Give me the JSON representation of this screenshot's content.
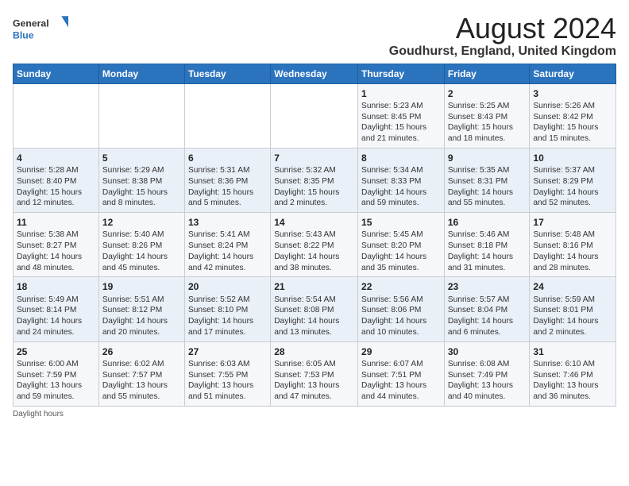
{
  "logo": {
    "line1": "General",
    "line2": "Blue"
  },
  "title": "August 2024",
  "subtitle": "Goudhurst, England, United Kingdom",
  "days_of_week": [
    "Sunday",
    "Monday",
    "Tuesday",
    "Wednesday",
    "Thursday",
    "Friday",
    "Saturday"
  ],
  "weeks": [
    [
      {
        "day": "",
        "content": ""
      },
      {
        "day": "",
        "content": ""
      },
      {
        "day": "",
        "content": ""
      },
      {
        "day": "",
        "content": ""
      },
      {
        "day": "1",
        "content": "Sunrise: 5:23 AM\nSunset: 8:45 PM\nDaylight: 15 hours\nand 21 minutes."
      },
      {
        "day": "2",
        "content": "Sunrise: 5:25 AM\nSunset: 8:43 PM\nDaylight: 15 hours\nand 18 minutes."
      },
      {
        "day": "3",
        "content": "Sunrise: 5:26 AM\nSunset: 8:42 PM\nDaylight: 15 hours\nand 15 minutes."
      }
    ],
    [
      {
        "day": "4",
        "content": "Sunrise: 5:28 AM\nSunset: 8:40 PM\nDaylight: 15 hours\nand 12 minutes."
      },
      {
        "day": "5",
        "content": "Sunrise: 5:29 AM\nSunset: 8:38 PM\nDaylight: 15 hours\nand 8 minutes."
      },
      {
        "day": "6",
        "content": "Sunrise: 5:31 AM\nSunset: 8:36 PM\nDaylight: 15 hours\nand 5 minutes."
      },
      {
        "day": "7",
        "content": "Sunrise: 5:32 AM\nSunset: 8:35 PM\nDaylight: 15 hours\nand 2 minutes."
      },
      {
        "day": "8",
        "content": "Sunrise: 5:34 AM\nSunset: 8:33 PM\nDaylight: 14 hours\nand 59 minutes."
      },
      {
        "day": "9",
        "content": "Sunrise: 5:35 AM\nSunset: 8:31 PM\nDaylight: 14 hours\nand 55 minutes."
      },
      {
        "day": "10",
        "content": "Sunrise: 5:37 AM\nSunset: 8:29 PM\nDaylight: 14 hours\nand 52 minutes."
      }
    ],
    [
      {
        "day": "11",
        "content": "Sunrise: 5:38 AM\nSunset: 8:27 PM\nDaylight: 14 hours\nand 48 minutes."
      },
      {
        "day": "12",
        "content": "Sunrise: 5:40 AM\nSunset: 8:26 PM\nDaylight: 14 hours\nand 45 minutes."
      },
      {
        "day": "13",
        "content": "Sunrise: 5:41 AM\nSunset: 8:24 PM\nDaylight: 14 hours\nand 42 minutes."
      },
      {
        "day": "14",
        "content": "Sunrise: 5:43 AM\nSunset: 8:22 PM\nDaylight: 14 hours\nand 38 minutes."
      },
      {
        "day": "15",
        "content": "Sunrise: 5:45 AM\nSunset: 8:20 PM\nDaylight: 14 hours\nand 35 minutes."
      },
      {
        "day": "16",
        "content": "Sunrise: 5:46 AM\nSunset: 8:18 PM\nDaylight: 14 hours\nand 31 minutes."
      },
      {
        "day": "17",
        "content": "Sunrise: 5:48 AM\nSunset: 8:16 PM\nDaylight: 14 hours\nand 28 minutes."
      }
    ],
    [
      {
        "day": "18",
        "content": "Sunrise: 5:49 AM\nSunset: 8:14 PM\nDaylight: 14 hours\nand 24 minutes."
      },
      {
        "day": "19",
        "content": "Sunrise: 5:51 AM\nSunset: 8:12 PM\nDaylight: 14 hours\nand 20 minutes."
      },
      {
        "day": "20",
        "content": "Sunrise: 5:52 AM\nSunset: 8:10 PM\nDaylight: 14 hours\nand 17 minutes."
      },
      {
        "day": "21",
        "content": "Sunrise: 5:54 AM\nSunset: 8:08 PM\nDaylight: 14 hours\nand 13 minutes."
      },
      {
        "day": "22",
        "content": "Sunrise: 5:56 AM\nSunset: 8:06 PM\nDaylight: 14 hours\nand 10 minutes."
      },
      {
        "day": "23",
        "content": "Sunrise: 5:57 AM\nSunset: 8:04 PM\nDaylight: 14 hours\nand 6 minutes."
      },
      {
        "day": "24",
        "content": "Sunrise: 5:59 AM\nSunset: 8:01 PM\nDaylight: 14 hours\nand 2 minutes."
      }
    ],
    [
      {
        "day": "25",
        "content": "Sunrise: 6:00 AM\nSunset: 7:59 PM\nDaylight: 13 hours\nand 59 minutes."
      },
      {
        "day": "26",
        "content": "Sunrise: 6:02 AM\nSunset: 7:57 PM\nDaylight: 13 hours\nand 55 minutes."
      },
      {
        "day": "27",
        "content": "Sunrise: 6:03 AM\nSunset: 7:55 PM\nDaylight: 13 hours\nand 51 minutes."
      },
      {
        "day": "28",
        "content": "Sunrise: 6:05 AM\nSunset: 7:53 PM\nDaylight: 13 hours\nand 47 minutes."
      },
      {
        "day": "29",
        "content": "Sunrise: 6:07 AM\nSunset: 7:51 PM\nDaylight: 13 hours\nand 44 minutes."
      },
      {
        "day": "30",
        "content": "Sunrise: 6:08 AM\nSunset: 7:49 PM\nDaylight: 13 hours\nand 40 minutes."
      },
      {
        "day": "31",
        "content": "Sunrise: 6:10 AM\nSunset: 7:46 PM\nDaylight: 13 hours\nand 36 minutes."
      }
    ]
  ],
  "footer": "Daylight hours"
}
